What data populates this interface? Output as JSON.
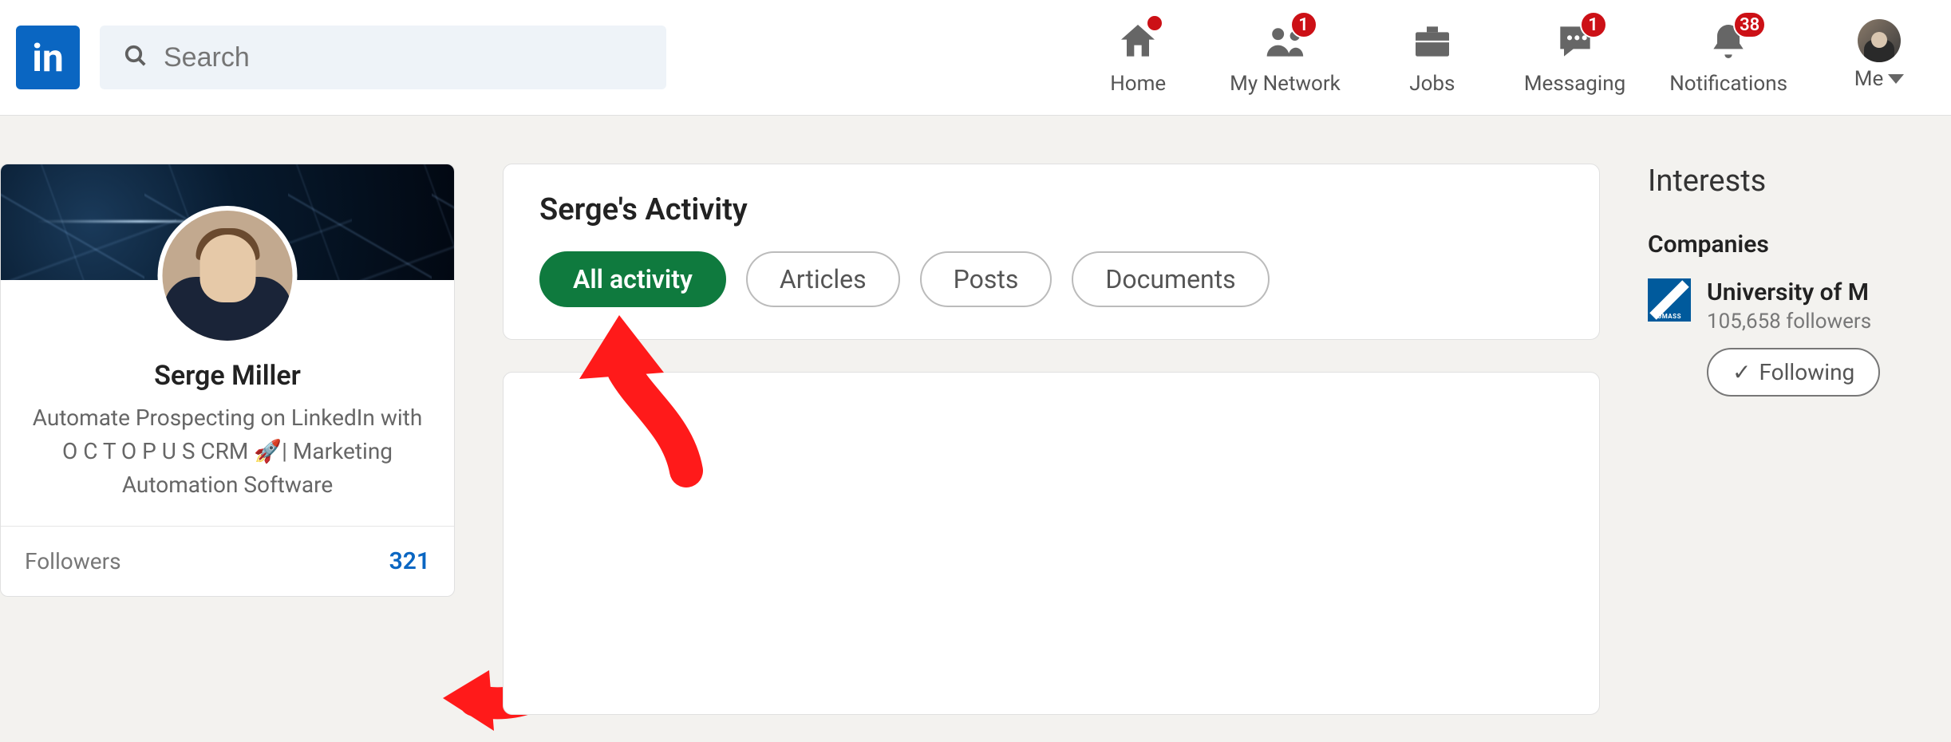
{
  "header": {
    "logo_text": "in",
    "search_placeholder": "Search",
    "nav": {
      "home": {
        "label": "Home",
        "badge": ""
      },
      "network": {
        "label": "My Network",
        "badge": "1"
      },
      "jobs": {
        "label": "Jobs",
        "badge": ""
      },
      "messaging": {
        "label": "Messaging",
        "badge": "1"
      },
      "notifications": {
        "label": "Notifications",
        "badge": "38"
      },
      "me": {
        "label": "Me"
      }
    }
  },
  "profile": {
    "name": "Serge Miller",
    "headline": "Automate Prospecting on LinkedIn with O C T O P U S CRM 🚀| Marketing Automation Software",
    "followers_label": "Followers",
    "followers_count": "321"
  },
  "activity": {
    "title": "Serge's Activity",
    "tabs": {
      "all": "All activity",
      "articles": "Articles",
      "posts": "Posts",
      "documents": "Documents"
    }
  },
  "interests": {
    "title": "Interests",
    "section": "Companies",
    "company": {
      "name": "University of M",
      "followers": "105,658 followers",
      "follow_btn": "Following",
      "logo_tag": "UMASS"
    }
  }
}
